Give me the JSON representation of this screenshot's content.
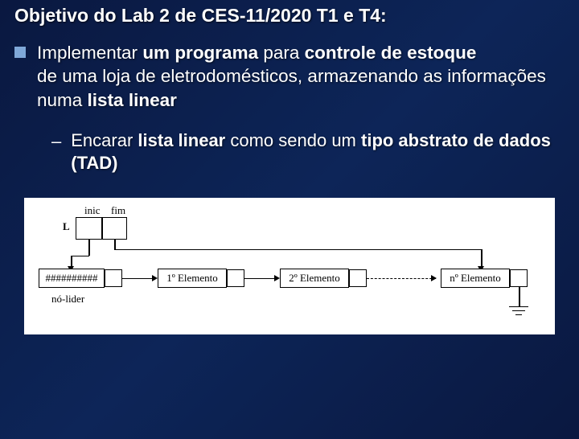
{
  "title": "Objetivo do Lab 2 de CES-11/2020 T1 e T4:",
  "bullet": {
    "p1": "Implementar",
    "p2_bold": "um programa",
    "p3": " para ",
    "p4_bold": "controle de estoque",
    "p5": "de uma loja de eletrodomésticos, armazenando as informações numa ",
    "p6_bold": "lista linear"
  },
  "sub": {
    "p1": "Encarar ",
    "p2_bold": "lista linear",
    "p3": " como sendo um ",
    "p4_bold": "tipo abstrato de dados (TAD)"
  },
  "diagram": {
    "inic": "inic",
    "fim": "fim",
    "L": "L",
    "hash": "##########",
    "no_lider": "nó-lider",
    "el1": "1º Elemento",
    "el2": "2º Elemento",
    "eln": "nº Elemento"
  }
}
